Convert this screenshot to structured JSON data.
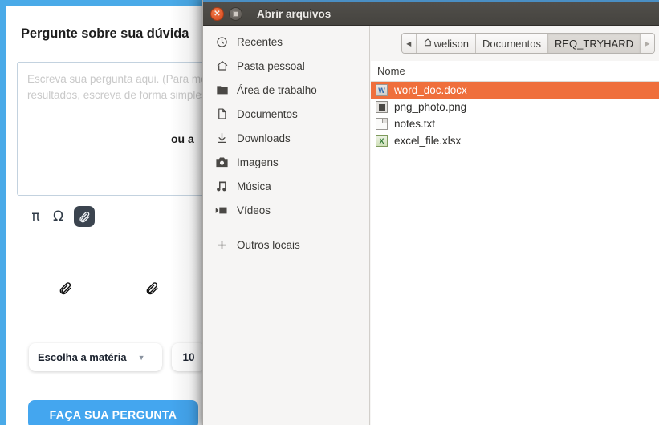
{
  "background_page": {
    "title": "Pergunte sobre sua dúvida",
    "question_box": {
      "placeholder": "Escreva sua pergunta aqui. (Para melhores resultados, escreva de forma simples e clara)",
      "value": ""
    },
    "or_attach_label": "ou a",
    "toolbar": {
      "pi_label": "π",
      "omega_label": "Ω",
      "attach_icon": "paperclip-icon"
    },
    "attach_slots": [
      {
        "icon": "paperclip-icon"
      },
      {
        "icon": "paperclip-icon"
      }
    ],
    "subject_select": {
      "label": "Escolha a matéria",
      "chevron": "▼"
    },
    "points_field": {
      "value": "10"
    },
    "submit_button": {
      "label": "FAÇA SUA PERGUNTA"
    },
    "colors": {
      "accent_blue": "#44a6ef",
      "stripe_blue": "#4aaae8",
      "text_dark": "#1d2430"
    }
  },
  "dialog": {
    "title": "Abrir arquivos",
    "window_buttons": {
      "close_label": "✕",
      "close_icon": "close-icon",
      "maximize_icon": "maximize-icon"
    },
    "sidebar": {
      "items": [
        {
          "label": "Recentes",
          "icon": "clock-icon"
        },
        {
          "label": "Pasta pessoal",
          "icon": "home-icon"
        },
        {
          "label": "Área de trabalho",
          "icon": "folder-icon"
        },
        {
          "label": "Documentos",
          "icon": "document-icon"
        },
        {
          "label": "Downloads",
          "icon": "download-icon"
        },
        {
          "label": "Imagens",
          "icon": "camera-icon"
        },
        {
          "label": "Música",
          "icon": "music-note-icon"
        },
        {
          "label": "Vídeos",
          "icon": "video-icon"
        }
      ],
      "other_locations": {
        "label": "Outros locais",
        "icon": "plus-icon"
      }
    },
    "pathbar": {
      "back_arrow": "◀",
      "forward_arrow": "▶",
      "crumbs": [
        {
          "label": "welison",
          "icon": "home-icon",
          "active": false
        },
        {
          "label": "Documentos",
          "icon": "",
          "active": false
        },
        {
          "label": "REQ_TRYHARD",
          "icon": "",
          "active": true
        }
      ]
    },
    "filelist": {
      "column_header": "Nome",
      "rows": [
        {
          "name": "word_doc.docx",
          "icon": "word-file-icon",
          "selected": true
        },
        {
          "name": "png_photo.png",
          "icon": "image-file-icon",
          "selected": false
        },
        {
          "name": "notes.txt",
          "icon": "text-file-icon",
          "selected": false
        },
        {
          "name": "excel_file.xlsx",
          "icon": "excel-file-icon",
          "selected": false
        }
      ]
    },
    "colors": {
      "titlebar": "#4a4845",
      "selection_orange": "#ef6f3c",
      "sidebar_bg": "#f6f5f4",
      "top_border_blue": "#4a8fc4"
    }
  }
}
